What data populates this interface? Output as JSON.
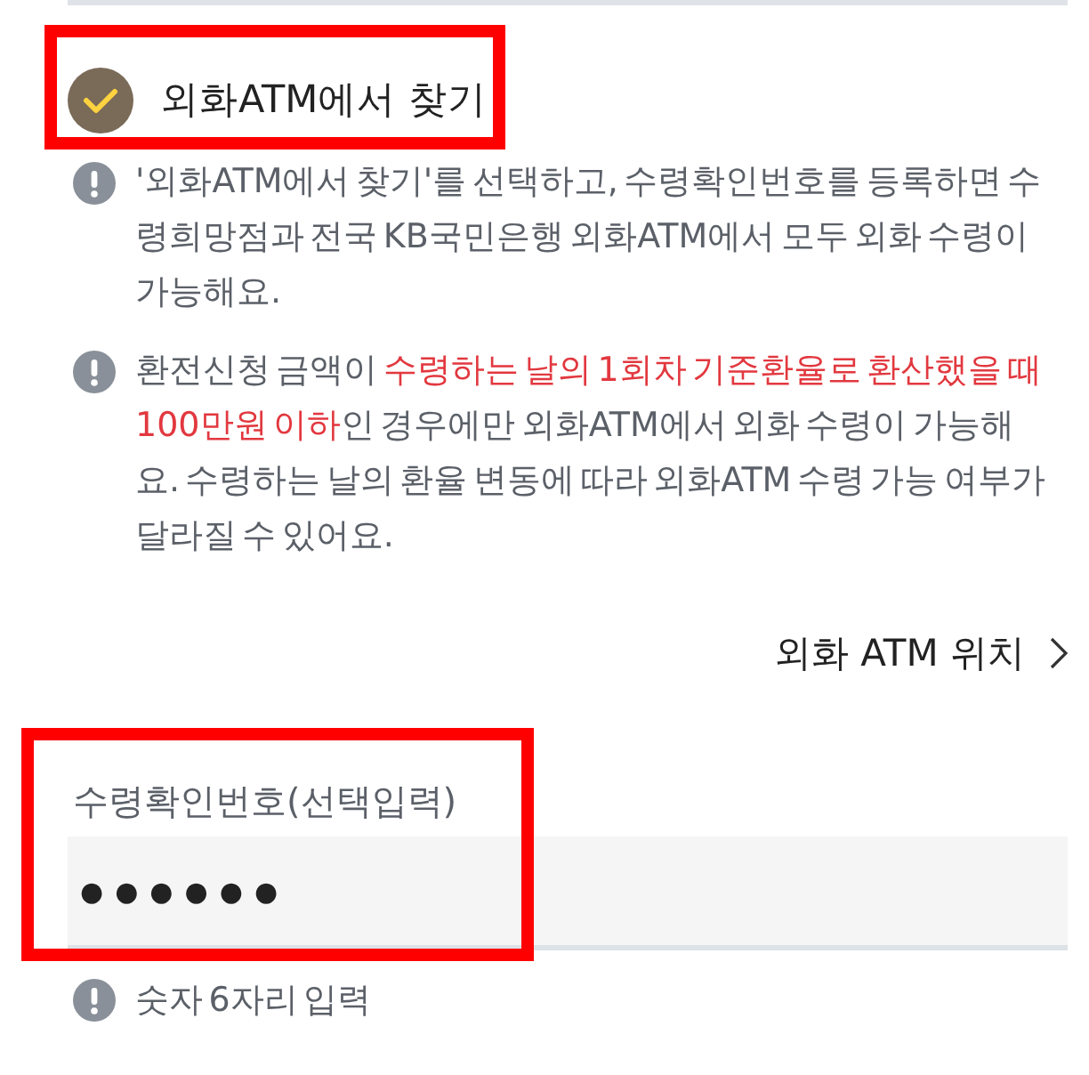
{
  "option": {
    "label": "외화ATM에서 찾기",
    "checked": true,
    "highlighted": true
  },
  "notes": [
    {
      "segments": [
        {
          "text": "'외화ATM에서 찾기'를 선택하고, 수령확인번호를 등록하면 수령희망점과 전국 KB국민은행 외화ATM에서 모두 외화 수령이 가능해요.",
          "emphasis": false
        }
      ]
    },
    {
      "segments": [
        {
          "text": "환전신청 금액이 ",
          "emphasis": false
        },
        {
          "text": "수령하는 날의 1회차 기준환율로 환산했을 때 100만원 이하",
          "emphasis": true
        },
        {
          "text": "인 경우에만 외화ATM에서 외화 수령이 가능해요. 수령하는 날의 환율 변동에 따라 외화ATM 수령 가능 여부가 달라질 수 있어요.",
          "emphasis": false
        }
      ]
    }
  ],
  "link": {
    "label": "외화 ATM 위치"
  },
  "field": {
    "label": "수령확인번호(선택입력)",
    "value": "●●●●●●",
    "highlighted": true
  },
  "hint": {
    "text": "숫자 6자리 입력"
  }
}
